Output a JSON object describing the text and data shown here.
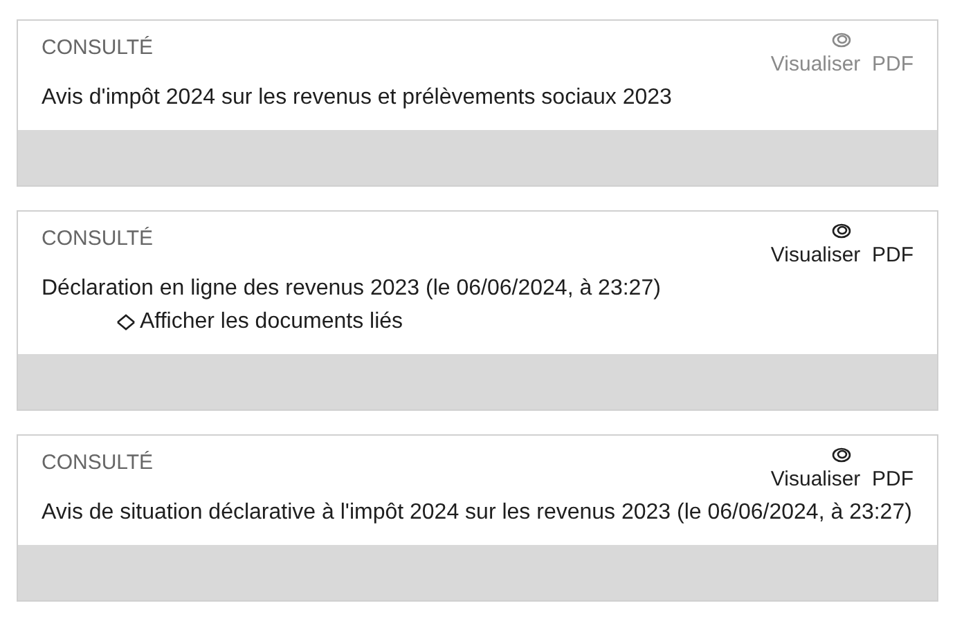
{
  "documents": [
    {
      "status": "CONSULTÉ",
      "button": {
        "label": "Visualiser  PDF",
        "disabled": true
      },
      "title": "Avis d'impôt 2024 sur les revenus et prélèvements sociaux 2023"
    },
    {
      "status": "CONSULTÉ",
      "button": {
        "label": "Visualiser  PDF",
        "disabled": false
      },
      "title": "Déclaration en ligne des revenus 2023 (le 06/06/2024, à 23:27)",
      "related_link": "Afficher les documents liés"
    },
    {
      "status": "CONSULTÉ",
      "button": {
        "label": "Visualiser  PDF",
        "disabled": false
      },
      "title": "Avis de situation déclarative à l'impôt 2024 sur les revenus 2023 (le 06/06/2024, à 23:27)"
    }
  ]
}
